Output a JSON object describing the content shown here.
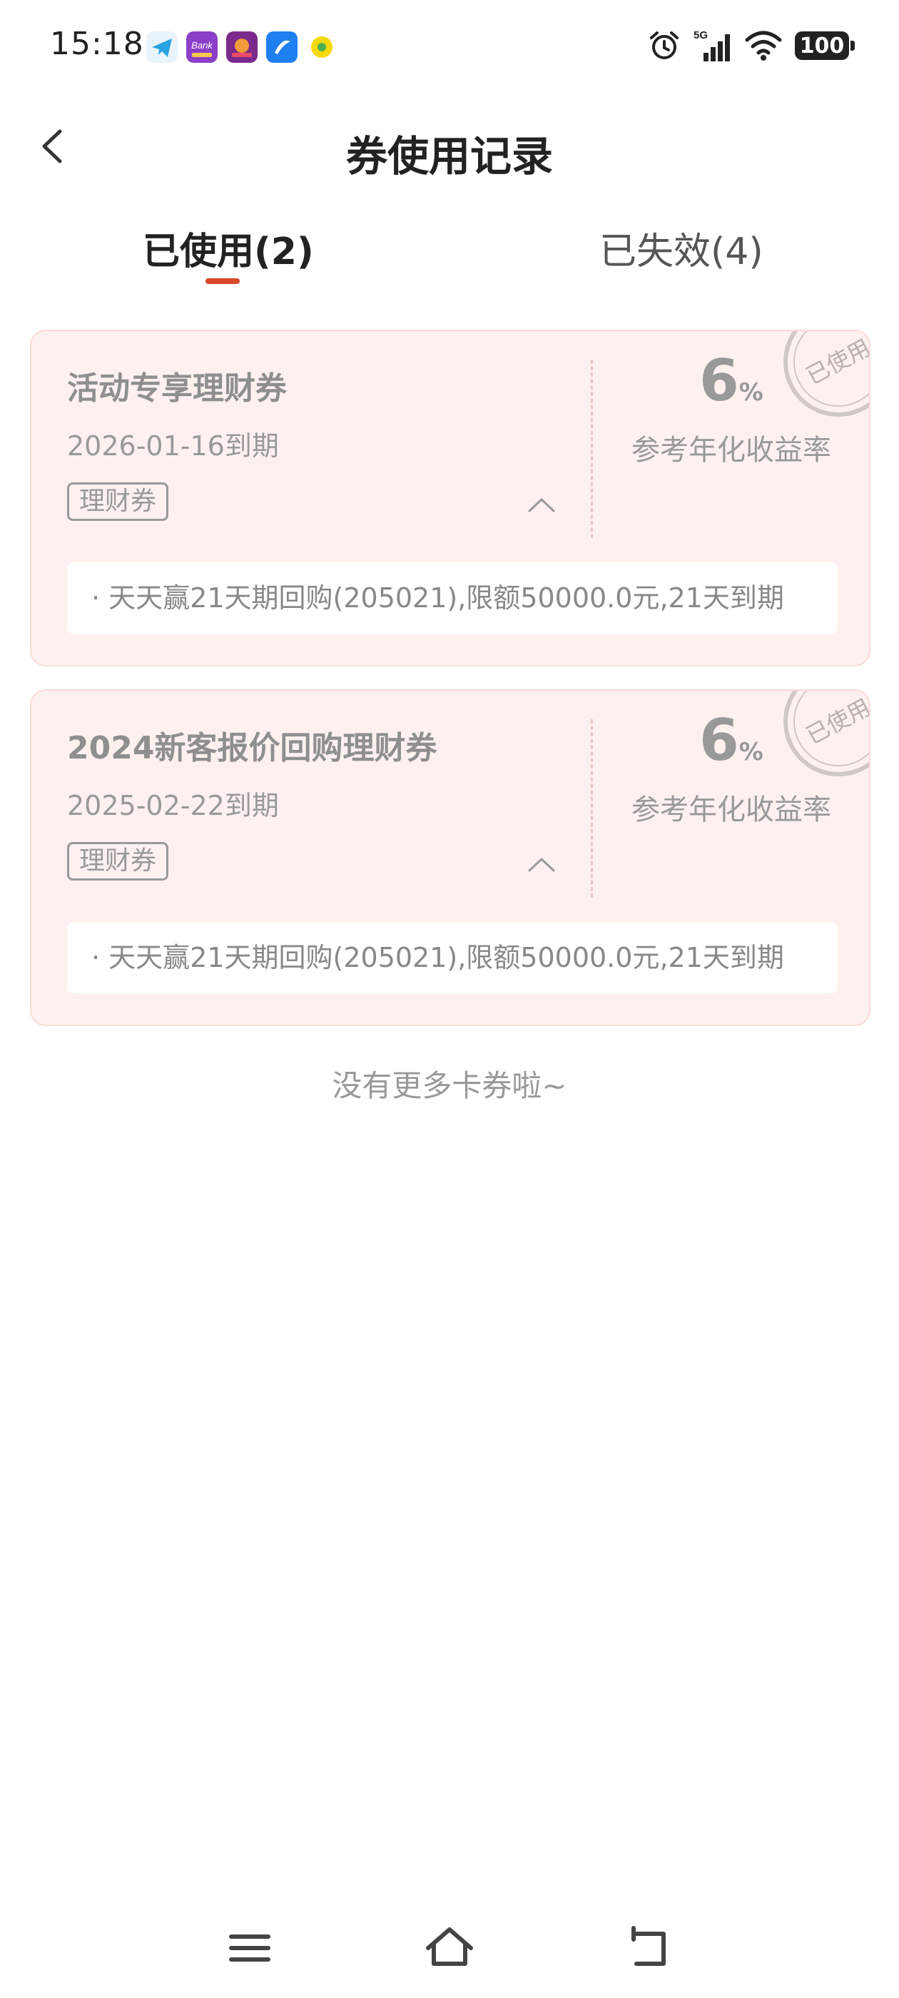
{
  "status_bar": {
    "time": "15:18",
    "app_icons": [
      "telegram-icon",
      "bank-app-icon",
      "reader-app-icon",
      "browser-app-icon",
      "lemon-app-icon"
    ],
    "network_label": "5G",
    "battery": "100"
  },
  "header": {
    "title": "券使用记录",
    "back_icon": "chevron-left-icon"
  },
  "tabs": [
    {
      "label": "已使用(2)",
      "active": true
    },
    {
      "label": "已失效(4)",
      "active": false
    }
  ],
  "coupons": [
    {
      "name": "活动专享理财券",
      "expiry": "2026-01-16到期",
      "tag": "理财券",
      "rate_value": "6",
      "rate_unit": "%",
      "rate_label": "参考年化收益率",
      "stamp": "已使用",
      "detail": "· 天天赢21天期回购(205021),限额50000.0元,21天到期"
    },
    {
      "name": "2024新客报价回购理财券",
      "expiry": "2025-02-22到期",
      "tag": "理财券",
      "rate_value": "6",
      "rate_unit": "%",
      "rate_label": "参考年化收益率",
      "stamp": "已使用",
      "detail": "· 天天赢21天期回购(205021),限额50000.0元,21天到期"
    }
  ],
  "footer_note": "没有更多卡券啦~",
  "system_nav": [
    "menu-icon",
    "home-icon",
    "back-icon"
  ],
  "colors": {
    "accent": "#d7472a",
    "card_bg": "#fdf1ef",
    "card_border": "#f8dcd7",
    "muted_text": "#999999"
  }
}
